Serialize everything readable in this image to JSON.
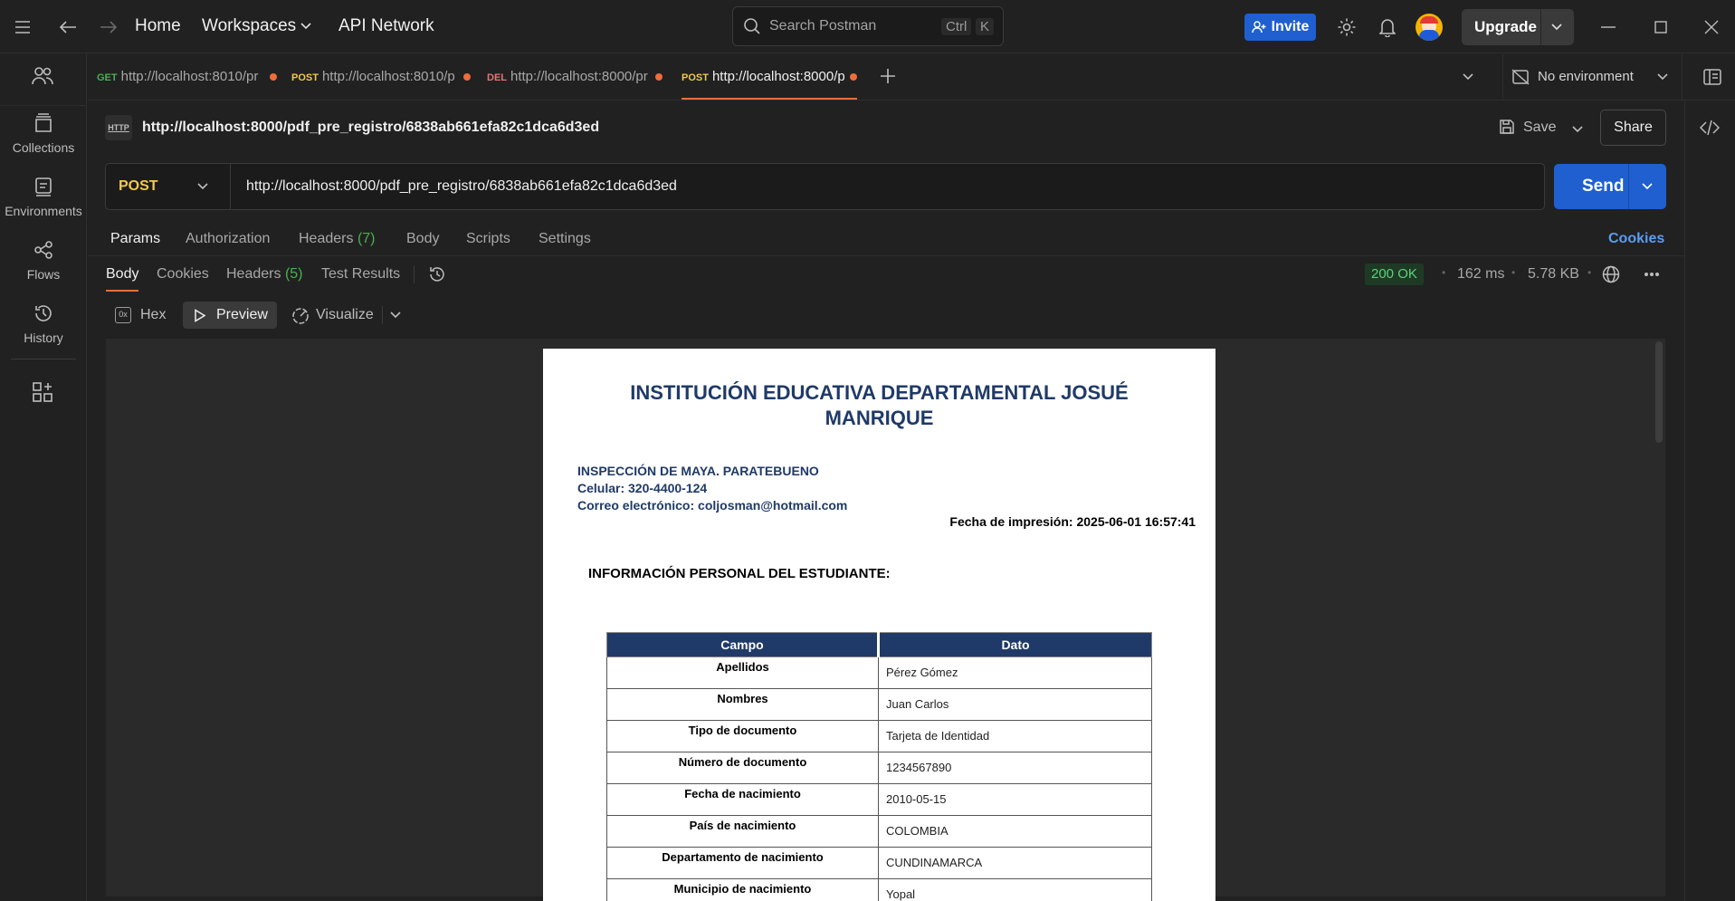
{
  "topbar": {
    "home": "Home",
    "workspaces": "Workspaces",
    "api_network": "API Network",
    "search_placeholder": "Search Postman",
    "kbd_ctrl": "Ctrl",
    "kbd_k": "K",
    "invite": "Invite",
    "upgrade": "Upgrade"
  },
  "sidebar": {
    "items": [
      {
        "label": "Collections",
        "icon": "collections-icon"
      },
      {
        "label": "Environments",
        "icon": "environments-icon"
      },
      {
        "label": "Flows",
        "icon": "flows-icon"
      },
      {
        "label": "History",
        "icon": "history-icon"
      }
    ]
  },
  "tabs": [
    {
      "method": "GET",
      "url": "http://localhost:8010/pr",
      "color": "#4caf50"
    },
    {
      "method": "POST",
      "url": "http://localhost:8010/p",
      "color": "#f2c94c"
    },
    {
      "method": "DEL",
      "url": "http://localhost:8000/pr",
      "color": "#e57373"
    },
    {
      "method": "POST",
      "url": "http://localhost:8000/p",
      "color": "#f2c94c",
      "active": true
    }
  ],
  "environment": "No environment",
  "request": {
    "icon_label": "HTTP",
    "name": "http://localhost:8000/pdf_pre_registro/6838ab661efa82c1dca6d3ed",
    "save": "Save",
    "share": "Share",
    "method": "POST",
    "url": "http://localhost:8000/pdf_pre_registro/6838ab661efa82c1dca6d3ed",
    "send": "Send"
  },
  "request_tabs": {
    "params": "Params",
    "authorization": "Authorization",
    "headers": "Headers",
    "headers_count": "(7)",
    "body": "Body",
    "scripts": "Scripts",
    "settings": "Settings",
    "cookies": "Cookies"
  },
  "response_tabs": {
    "body": "Body",
    "cookies": "Cookies",
    "headers": "Headers",
    "headers_count": "(5)",
    "test_results": "Test Results",
    "status": "200 OK",
    "time": "162 ms",
    "size": "5.78 KB"
  },
  "view_modes": {
    "hex": "Hex",
    "preview": "Preview",
    "visualize": "Visualize"
  },
  "pdf": {
    "title_line1": "INSTITUCIÓN EDUCATIVA DEPARTAMENTAL JOSUÉ",
    "title_line2": "MANRIQUE",
    "info1": "INSPECCIÓN DE MAYA. PARATEBUENO",
    "info2": "Celular: 320-4400-124",
    "info3": "Correo electrónico: coljosman@hotmail.com",
    "fecha": "Fecha de impresión: 2025-06-01 16:57:41",
    "section": "INFORMACIÓN PERSONAL DEL ESTUDIANTE:",
    "col_campo": "Campo",
    "col_dato": "Dato",
    "rows": [
      {
        "campo": "Apellidos",
        "dato": "Pérez Gómez"
      },
      {
        "campo": "Nombres",
        "dato": "Juan Carlos"
      },
      {
        "campo": "Tipo de documento",
        "dato": "Tarjeta de Identidad"
      },
      {
        "campo": "Número de documento",
        "dato": "1234567890"
      },
      {
        "campo": "Fecha de nacimiento",
        "dato": "2010-05-15"
      },
      {
        "campo": "País de nacimiento",
        "dato": "COLOMBIA"
      },
      {
        "campo": "Departamento de nacimiento",
        "dato": "CUNDINAMARCA"
      },
      {
        "campo": "Municipio de nacimiento",
        "dato": "Yopal"
      }
    ]
  }
}
